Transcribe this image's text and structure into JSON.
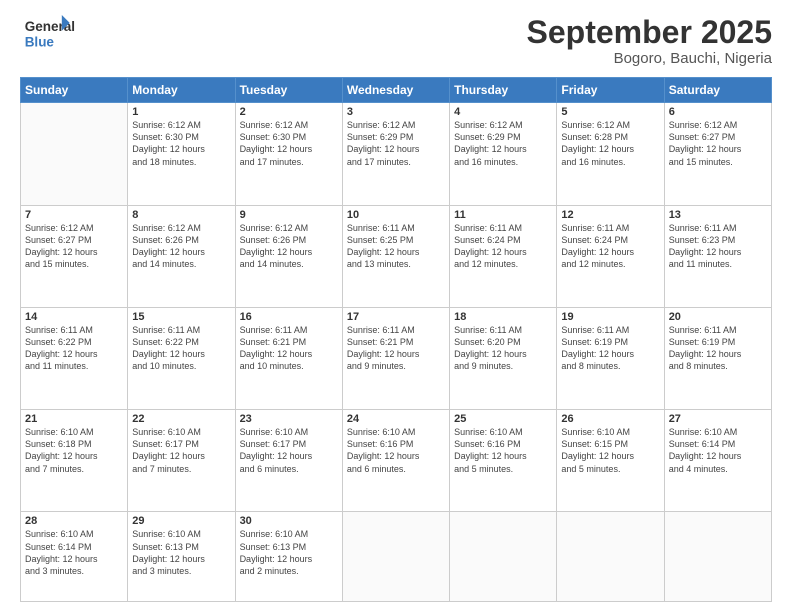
{
  "logo": {
    "line1": "General",
    "line2": "Blue"
  },
  "title": "September 2025",
  "subtitle": "Bogoro, Bauchi, Nigeria",
  "days": [
    "Sunday",
    "Monday",
    "Tuesday",
    "Wednesday",
    "Thursday",
    "Friday",
    "Saturday"
  ],
  "weeks": [
    [
      {
        "day": "",
        "text": ""
      },
      {
        "day": "1",
        "text": "Sunrise: 6:12 AM\nSunset: 6:30 PM\nDaylight: 12 hours\nand 18 minutes."
      },
      {
        "day": "2",
        "text": "Sunrise: 6:12 AM\nSunset: 6:30 PM\nDaylight: 12 hours\nand 17 minutes."
      },
      {
        "day": "3",
        "text": "Sunrise: 6:12 AM\nSunset: 6:29 PM\nDaylight: 12 hours\nand 17 minutes."
      },
      {
        "day": "4",
        "text": "Sunrise: 6:12 AM\nSunset: 6:29 PM\nDaylight: 12 hours\nand 16 minutes."
      },
      {
        "day": "5",
        "text": "Sunrise: 6:12 AM\nSunset: 6:28 PM\nDaylight: 12 hours\nand 16 minutes."
      },
      {
        "day": "6",
        "text": "Sunrise: 6:12 AM\nSunset: 6:27 PM\nDaylight: 12 hours\nand 15 minutes."
      }
    ],
    [
      {
        "day": "7",
        "text": "Sunrise: 6:12 AM\nSunset: 6:27 PM\nDaylight: 12 hours\nand 15 minutes."
      },
      {
        "day": "8",
        "text": "Sunrise: 6:12 AM\nSunset: 6:26 PM\nDaylight: 12 hours\nand 14 minutes."
      },
      {
        "day": "9",
        "text": "Sunrise: 6:12 AM\nSunset: 6:26 PM\nDaylight: 12 hours\nand 14 minutes."
      },
      {
        "day": "10",
        "text": "Sunrise: 6:11 AM\nSunset: 6:25 PM\nDaylight: 12 hours\nand 13 minutes."
      },
      {
        "day": "11",
        "text": "Sunrise: 6:11 AM\nSunset: 6:24 PM\nDaylight: 12 hours\nand 12 minutes."
      },
      {
        "day": "12",
        "text": "Sunrise: 6:11 AM\nSunset: 6:24 PM\nDaylight: 12 hours\nand 12 minutes."
      },
      {
        "day": "13",
        "text": "Sunrise: 6:11 AM\nSunset: 6:23 PM\nDaylight: 12 hours\nand 11 minutes."
      }
    ],
    [
      {
        "day": "14",
        "text": "Sunrise: 6:11 AM\nSunset: 6:22 PM\nDaylight: 12 hours\nand 11 minutes."
      },
      {
        "day": "15",
        "text": "Sunrise: 6:11 AM\nSunset: 6:22 PM\nDaylight: 12 hours\nand 10 minutes."
      },
      {
        "day": "16",
        "text": "Sunrise: 6:11 AM\nSunset: 6:21 PM\nDaylight: 12 hours\nand 10 minutes."
      },
      {
        "day": "17",
        "text": "Sunrise: 6:11 AM\nSunset: 6:21 PM\nDaylight: 12 hours\nand 9 minutes."
      },
      {
        "day": "18",
        "text": "Sunrise: 6:11 AM\nSunset: 6:20 PM\nDaylight: 12 hours\nand 9 minutes."
      },
      {
        "day": "19",
        "text": "Sunrise: 6:11 AM\nSunset: 6:19 PM\nDaylight: 12 hours\nand 8 minutes."
      },
      {
        "day": "20",
        "text": "Sunrise: 6:11 AM\nSunset: 6:19 PM\nDaylight: 12 hours\nand 8 minutes."
      }
    ],
    [
      {
        "day": "21",
        "text": "Sunrise: 6:10 AM\nSunset: 6:18 PM\nDaylight: 12 hours\nand 7 minutes."
      },
      {
        "day": "22",
        "text": "Sunrise: 6:10 AM\nSunset: 6:17 PM\nDaylight: 12 hours\nand 7 minutes."
      },
      {
        "day": "23",
        "text": "Sunrise: 6:10 AM\nSunset: 6:17 PM\nDaylight: 12 hours\nand 6 minutes."
      },
      {
        "day": "24",
        "text": "Sunrise: 6:10 AM\nSunset: 6:16 PM\nDaylight: 12 hours\nand 6 minutes."
      },
      {
        "day": "25",
        "text": "Sunrise: 6:10 AM\nSunset: 6:16 PM\nDaylight: 12 hours\nand 5 minutes."
      },
      {
        "day": "26",
        "text": "Sunrise: 6:10 AM\nSunset: 6:15 PM\nDaylight: 12 hours\nand 5 minutes."
      },
      {
        "day": "27",
        "text": "Sunrise: 6:10 AM\nSunset: 6:14 PM\nDaylight: 12 hours\nand 4 minutes."
      }
    ],
    [
      {
        "day": "28",
        "text": "Sunrise: 6:10 AM\nSunset: 6:14 PM\nDaylight: 12 hours\nand 3 minutes."
      },
      {
        "day": "29",
        "text": "Sunrise: 6:10 AM\nSunset: 6:13 PM\nDaylight: 12 hours\nand 3 minutes."
      },
      {
        "day": "30",
        "text": "Sunrise: 6:10 AM\nSunset: 6:13 PM\nDaylight: 12 hours\nand 2 minutes."
      },
      {
        "day": "",
        "text": ""
      },
      {
        "day": "",
        "text": ""
      },
      {
        "day": "",
        "text": ""
      },
      {
        "day": "",
        "text": ""
      }
    ]
  ]
}
